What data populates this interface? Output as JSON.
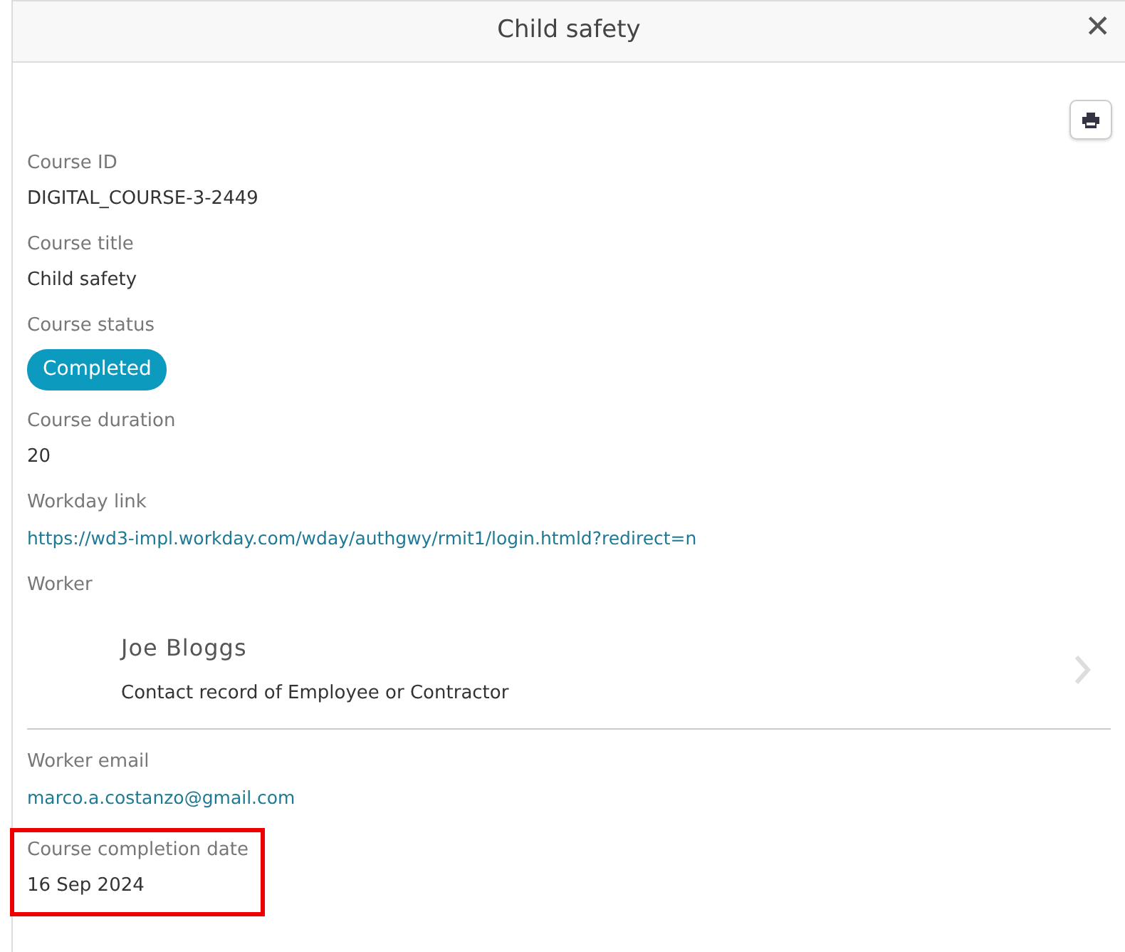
{
  "dialog": {
    "title": "Child safety",
    "close_icon": "✕"
  },
  "fields": [
    {
      "kind": "text",
      "label": "Course ID",
      "value": "DIGITAL_COURSE-3-2449",
      "highlighted": false
    },
    {
      "kind": "text",
      "label": "Course title",
      "value": "Child safety",
      "highlighted": false
    },
    {
      "kind": "badge",
      "label": "Course status",
      "value": "Completed",
      "highlighted": false
    },
    {
      "kind": "text",
      "label": "Course duration",
      "value": "20",
      "highlighted": false
    },
    {
      "kind": "link",
      "label": "Workday link",
      "value": "https://wd3-impl.workday.com/wday/authgwy/rmit1/login.htmld?redirect=n",
      "highlighted": false
    },
    {
      "kind": "worker",
      "label": "Worker",
      "name": "Joe Bloggs",
      "subtitle": "Contact record of Employee or Contractor",
      "highlighted": false
    },
    {
      "kind": "link",
      "label": "Worker email",
      "value": "marco.a.costanzo@gmail.com",
      "highlighted": false
    },
    {
      "kind": "text",
      "label": "Course completion date",
      "value": "16 Sep 2024",
      "highlighted": true
    }
  ]
}
